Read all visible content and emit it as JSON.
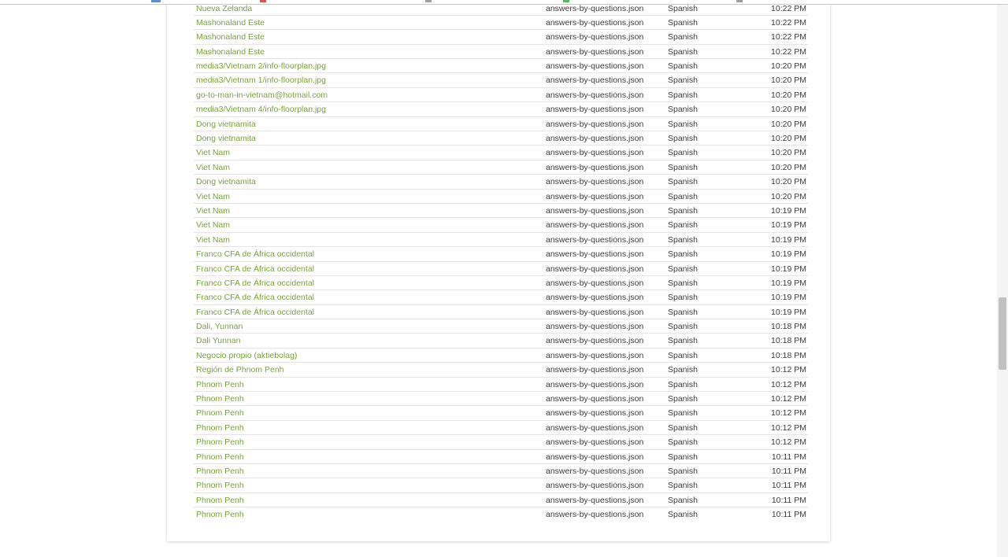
{
  "rows": [
    {
      "name": "Nueva Zelanda",
      "file": "answers-by-questions.json",
      "language": "Spanish",
      "time": "10:22 PM"
    },
    {
      "name": "Mashonaland Este",
      "file": "answers-by-questions.json",
      "language": "Spanish",
      "time": "10:22 PM"
    },
    {
      "name": "Mashonaland Este",
      "file": "answers-by-questions.json",
      "language": "Spanish",
      "time": "10:22 PM"
    },
    {
      "name": "Mashonaland Este",
      "file": "answers-by-questions.json",
      "language": "Spanish",
      "time": "10:22 PM"
    },
    {
      "name": "media3/Vietnam 2/info-floorplan.jpg",
      "file": "answers-by-questions.json",
      "language": "Spanish",
      "time": "10:20 PM"
    },
    {
      "name": "media3/Vietnam 1/info-floorplan.jpg",
      "file": "answers-by-questions.json",
      "language": "Spanish",
      "time": "10:20 PM"
    },
    {
      "name": "go-to-man-in-vietnam@hotmail.com",
      "file": "answers-by-questions.json",
      "language": "Spanish",
      "time": "10:20 PM"
    },
    {
      "name": "media3/Vietnam 4/info-floorplan.jpg",
      "file": "answers-by-questions.json",
      "language": "Spanish",
      "time": "10:20 PM"
    },
    {
      "name": "Dong vietnamita",
      "file": "answers-by-questions.json",
      "language": "Spanish",
      "time": "10:20 PM"
    },
    {
      "name": "Dong vietnamita",
      "file": "answers-by-questions.json",
      "language": "Spanish",
      "time": "10:20 PM"
    },
    {
      "name": "Viet Nam",
      "file": "answers-by-questions.json",
      "language": "Spanish",
      "time": "10:20 PM"
    },
    {
      "name": "Viet Nam",
      "file": "answers-by-questions.json",
      "language": "Spanish",
      "time": "10:20 PM"
    },
    {
      "name": "Dong vietnamita",
      "file": "answers-by-questions.json",
      "language": "Spanish",
      "time": "10:20 PM"
    },
    {
      "name": "Viet Nam",
      "file": "answers-by-questions.json",
      "language": "Spanish",
      "time": "10:20 PM"
    },
    {
      "name": "Viet Nam",
      "file": "answers-by-questions.json",
      "language": "Spanish",
      "time": "10:19 PM"
    },
    {
      "name": "Viet Nam",
      "file": "answers-by-questions.json",
      "language": "Spanish",
      "time": "10:19 PM"
    },
    {
      "name": "Viet Nam",
      "file": "answers-by-questions.json",
      "language": "Spanish",
      "time": "10:19 PM"
    },
    {
      "name": "Franco CFA de África occidental",
      "file": "answers-by-questions.json",
      "language": "Spanish",
      "time": "10:19 PM"
    },
    {
      "name": "Franco CFA de África occidental",
      "file": "answers-by-questions.json",
      "language": "Spanish",
      "time": "10:19 PM"
    },
    {
      "name": "Franco CFA de África occidental",
      "file": "answers-by-questions.json",
      "language": "Spanish",
      "time": "10:19 PM"
    },
    {
      "name": "Franco CFA de África occidental",
      "file": "answers-by-questions.json",
      "language": "Spanish",
      "time": "10:19 PM"
    },
    {
      "name": "Franco CFA de África occidental",
      "file": "answers-by-questions.json",
      "language": "Spanish",
      "time": "10:19 PM"
    },
    {
      "name": "Dali, Yunnan",
      "file": "answers-by-questions.json",
      "language": "Spanish",
      "time": "10:18 PM"
    },
    {
      "name": "Dali Yunnan",
      "file": "answers-by-questions.json",
      "language": "Spanish",
      "time": "10:18 PM"
    },
    {
      "name": "Negocio propio (aktiebolag)",
      "file": "answers-by-questions.json",
      "language": "Spanish",
      "time": "10:18 PM"
    },
    {
      "name": "Región de Phnom Penh",
      "file": "answers-by-questions.json",
      "language": "Spanish",
      "time": "10:12 PM"
    },
    {
      "name": "Phnom Penh",
      "file": "answers-by-questions.json",
      "language": "Spanish",
      "time": "10:12 PM"
    },
    {
      "name": "Phnom Penh",
      "file": "answers-by-questions.json",
      "language": "Spanish",
      "time": "10:12 PM"
    },
    {
      "name": "Phnom Penh",
      "file": "answers-by-questions.json",
      "language": "Spanish",
      "time": "10:12 PM"
    },
    {
      "name": "Phnom Penh",
      "file": "answers-by-questions.json",
      "language": "Spanish",
      "time": "10:12 PM"
    },
    {
      "name": "Phnom Penh",
      "file": "answers-by-questions.json",
      "language": "Spanish",
      "time": "10:12 PM"
    },
    {
      "name": "Phnom Penh",
      "file": "answers-by-questions.json",
      "language": "Spanish",
      "time": "10:11 PM"
    },
    {
      "name": "Phnom Penh",
      "file": "answers-by-questions.json",
      "language": "Spanish",
      "time": "10:11 PM"
    },
    {
      "name": "Phnom Penh",
      "file": "answers-by-questions.json",
      "language": "Spanish",
      "time": "10:11 PM"
    },
    {
      "name": "Phnom Penh",
      "file": "answers-by-questions.json",
      "language": "Spanish",
      "time": "10:11 PM"
    },
    {
      "name": "Phnom Penh",
      "file": "answers-by-questions.json",
      "language": "Spanish",
      "time": "10:11 PM"
    }
  ],
  "colors": {
    "link": "#7aa23c",
    "text": "#3b3b3b",
    "row_divider": "#e6e6e6"
  }
}
